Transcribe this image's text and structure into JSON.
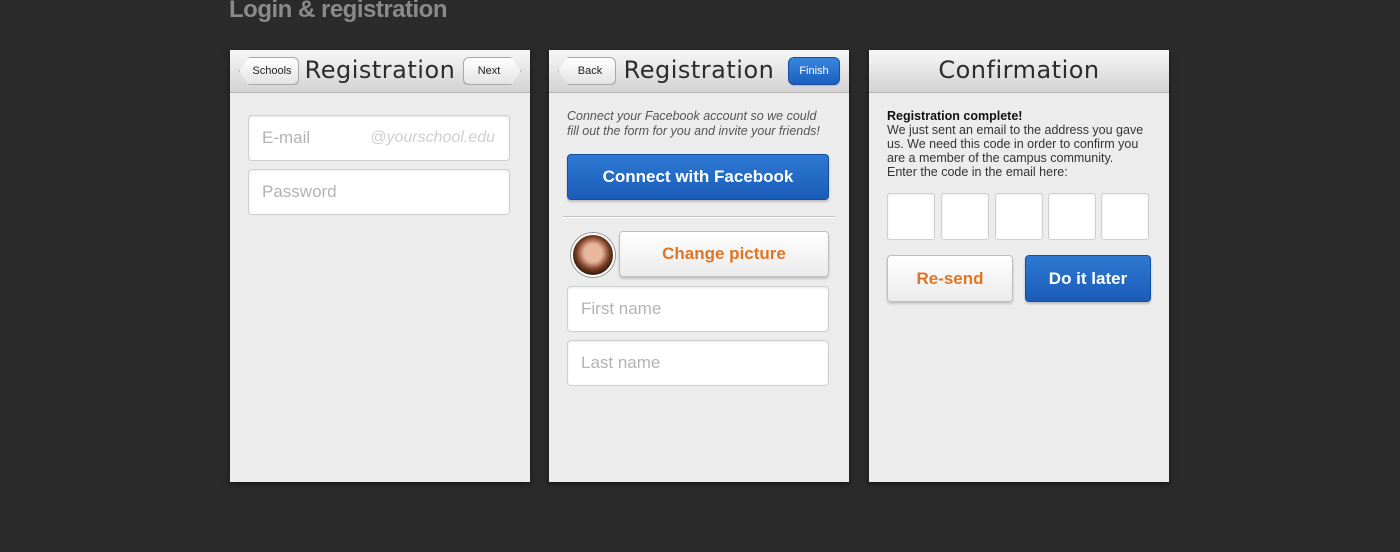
{
  "page": {
    "title": "Login & registration"
  },
  "screen1": {
    "title": "Registration",
    "left_button": "Schools",
    "right_button": "Next",
    "email_placeholder": "E-mail",
    "email_hint": "@yourschool.edu",
    "password_placeholder": "Password"
  },
  "screen2": {
    "title": "Registration",
    "left_button": "Back",
    "right_button": "Finish",
    "intro": "Connect your Facebook account so we could fill out the form for you and invite your friends!",
    "facebook_button": "Connect with Facebook",
    "change_picture_button": "Change picture",
    "first_name_placeholder": "First name",
    "last_name_placeholder": "Last name"
  },
  "screen3": {
    "title": "Confirmation",
    "heading": "Registration complete!",
    "message": "We just sent an email to the address you gave us. We need this code in order to confirm you are a member of the campus community.",
    "instruction": "Enter the code in the email here:",
    "code_boxes": 5,
    "resend_button": "Re-send",
    "later_button": "Do it later"
  },
  "colors": {
    "background": "#2b2b2b",
    "accent_blue": "#1a5fbf",
    "accent_orange": "#e07524"
  }
}
